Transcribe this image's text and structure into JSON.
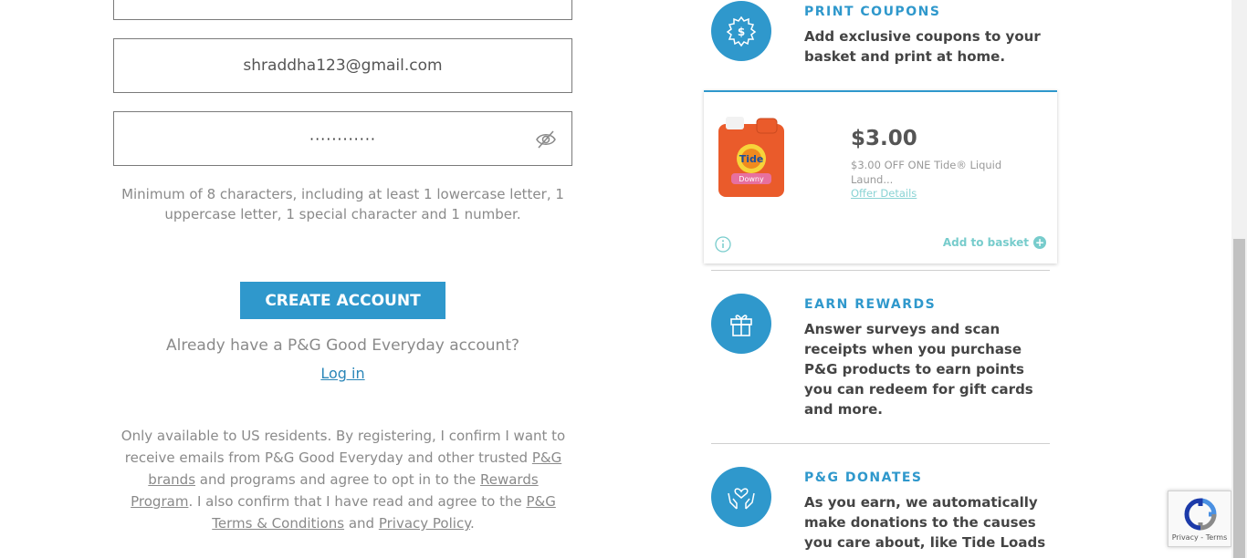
{
  "form": {
    "email_value": "shraddha123@gmail.com",
    "password_mask": "············",
    "password_hint": "Minimum of 8 characters, including at least 1 lowercase letter, 1 uppercase letter, 1 special character and 1 number.",
    "create_button": "CREATE ACCOUNT",
    "already_text": "Already have a P&G Good Everyday account?",
    "login_link": "Log in",
    "legal": {
      "part1": "Only available to US residents. By registering, I confirm I want to receive emails from P&G Good Everyday and other trusted ",
      "brands_link": "P&G brands",
      "part2": " and programs and agree to opt in to the ",
      "rewards_link": "Rewards Program",
      "part3": ". I also confirm that I have read and agree to the ",
      "terms_link": "P&G Terms & Conditions",
      "part4": " and ",
      "privacy_link": "Privacy Policy",
      "part5": "."
    }
  },
  "features": {
    "print": {
      "title": "PRINT COUPONS",
      "text": "Add exclusive coupons to your basket and print at home.",
      "icon": "dollar-badge-icon"
    },
    "rewards": {
      "title": "EARN REWARDS",
      "text": "Answer surveys and scan receipts when you purchase P&G products to earn points you can redeem for gift cards and more.",
      "icon": "gift-icon"
    },
    "donates": {
      "title": "P&G DONATES",
      "text": "As you earn, we automatically make donations to the causes you care about, like Tide Loads",
      "icon": "hands-heart-icon"
    }
  },
  "coupon": {
    "price": "$3.00",
    "description": "$3.00 OFF ONE Tide® Liquid Laund...",
    "offer_link": "Offer Details",
    "add_to_basket": "Add to basket",
    "product_label": "Tide",
    "product_sublabel": "Downy"
  },
  "recaptcha": {
    "terms": "Privacy - Terms"
  },
  "colors": {
    "accent": "#2f98cc",
    "teal": "#77cccc",
    "text": "#444444",
    "muted": "#8a8a8a"
  }
}
